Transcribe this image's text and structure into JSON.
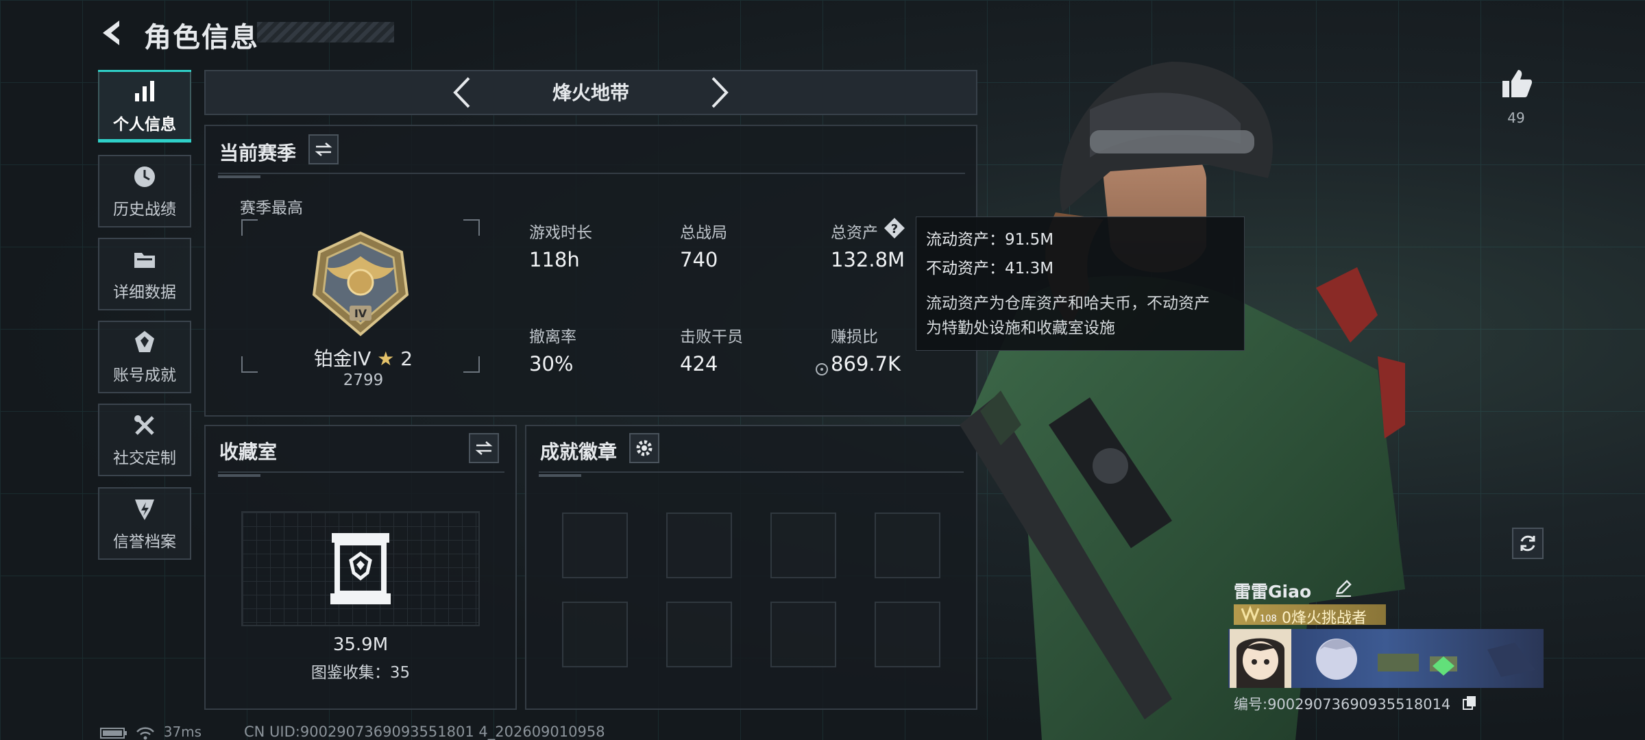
{
  "header": {
    "title": "角色信息"
  },
  "sidebar": {
    "items": [
      {
        "label": "个人信息",
        "icon": "bar-chart-icon"
      },
      {
        "label": "历史战绩",
        "icon": "history-clock-icon"
      },
      {
        "label": "详细数据",
        "icon": "folder-icon"
      },
      {
        "label": "账号成就",
        "icon": "achievement-icon"
      },
      {
        "label": "社交定制",
        "icon": "tools-icon"
      },
      {
        "label": "信誉档案",
        "icon": "credit-shield-icon"
      }
    ]
  },
  "mode": {
    "name": "烽火地带"
  },
  "season": {
    "title": "当前赛季",
    "best_label": "赛季最高",
    "rank_name": "铂金IV",
    "rank_roman": "IV",
    "rank_stars": "2",
    "rank_score": "2799",
    "stats": [
      {
        "label": "游戏时长",
        "value": "118h"
      },
      {
        "label": "总战局",
        "value": "740"
      },
      {
        "label": "总资产",
        "value": "132.8M"
      },
      {
        "label": "撤离率",
        "value": "30%"
      },
      {
        "label": "击败干员",
        "value": "424"
      },
      {
        "label": "赚损比",
        "value": "869.7K"
      }
    ]
  },
  "tooltip": {
    "liquid": "流动资产：91.5M",
    "fixed": "不动资产：41.3M",
    "desc_line1": "流动资产为仓库资产和哈夫币，不动资产",
    "desc_line2": "为特勤处设施和收藏室设施"
  },
  "collection": {
    "title": "收藏室",
    "value": "35.9M",
    "count_text": "图鉴收集：35"
  },
  "achievements": {
    "title": "成就徽章"
  },
  "right": {
    "likes": "49",
    "player_name": "雷雷Giao",
    "title_badge": "0烽火挑战者",
    "level": "108",
    "uid_text": "编号:900290736909355180​14"
  },
  "footer": {
    "ping": "37ms",
    "uid": "CN UID:9002907369093551801 4_202609010958"
  },
  "colors": {
    "accent": "#2fd0c8",
    "gold": "#b59a4c",
    "panel": "#161b20"
  }
}
